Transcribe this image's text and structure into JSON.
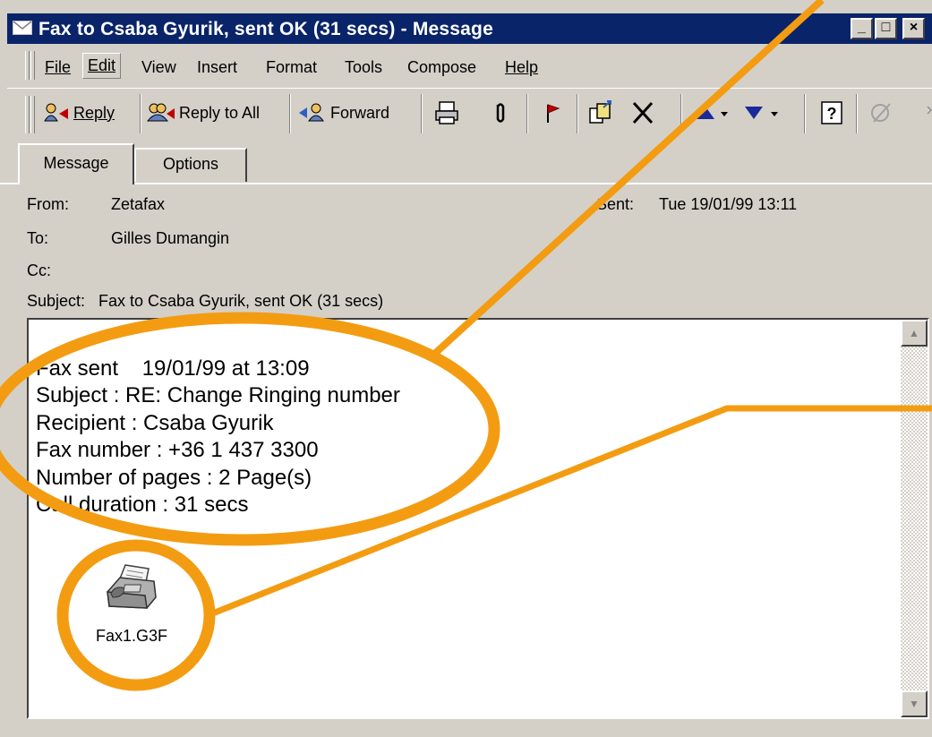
{
  "window": {
    "title": "Fax to Csaba Gyurik, sent OK (31 secs) - Message",
    "controls": {
      "minimize": "_",
      "maximize": "□",
      "close": "×"
    }
  },
  "menubar": {
    "items": [
      {
        "label": "File"
      },
      {
        "label": "Edit"
      },
      {
        "label": "View"
      },
      {
        "label": "Insert"
      },
      {
        "label": "Format"
      },
      {
        "label": "Tools"
      },
      {
        "label": "Compose"
      },
      {
        "label": "Help"
      }
    ]
  },
  "toolbar": {
    "reply_label": "Reply",
    "reply_all_label": "Reply to All",
    "forward_label": "Forward",
    "icons": [
      "print-icon",
      "paperclip-icon",
      "flag-icon",
      "move-to-folder-icon",
      "delete-icon",
      "previous-item-icon",
      "next-item-icon",
      "help-icon",
      "address-book-icon"
    ]
  },
  "tabs": [
    {
      "label": "Message",
      "active": true
    },
    {
      "label": "Options",
      "active": false
    }
  ],
  "header": {
    "from_label": "From:",
    "from_value": "Zetafax",
    "sent_label": "Sent:",
    "sent_value": "Tue 19/01/99 13:11",
    "to_label": "To:",
    "to_value": "Gilles Dumangin",
    "cc_label": "Cc:",
    "cc_value": "",
    "subject_label": "Subject:",
    "subject_value": "Fax to Csaba Gyurik, sent OK (31 secs)"
  },
  "body": {
    "lines": [
      "Fax sent    19/01/99 at 13:09",
      "",
      "Subject : RE: Change Ringing number",
      "Recipient : Csaba Gyurik",
      "Fax number : +36 1 437 3300",
      "Number of pages : 2 Page(s)",
      "Call duration : 31 secs"
    ],
    "attachment": {
      "filename": "Fax1.G3F",
      "icon": "fax-machine-icon"
    }
  },
  "colors": {
    "titlebar": "#0a246a",
    "chrome": "#d4d0c8",
    "callout": "#f39c12"
  }
}
